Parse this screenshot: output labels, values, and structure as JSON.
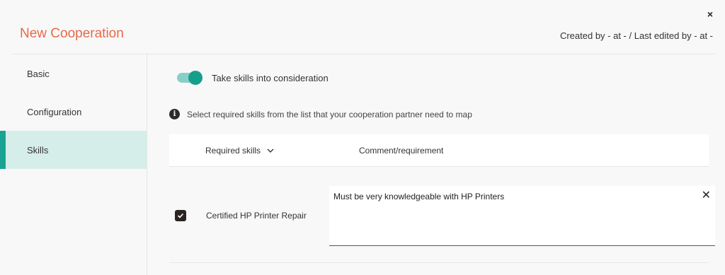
{
  "window": {
    "title": "New Cooperation",
    "meta": "Created by - at - / Last edited by - at -",
    "close_label": "×"
  },
  "sidebar": {
    "items": [
      {
        "label": "Basic",
        "active": false
      },
      {
        "label": "Configuration",
        "active": false
      },
      {
        "label": "Skills",
        "active": true
      }
    ]
  },
  "skills": {
    "toggle_label": "Take skills into consideration",
    "toggle_on": true,
    "info_text": "Select required skills from the list that your cooperation partner need to map",
    "info_icon_glyph": "i",
    "columns": {
      "skills": "Required skills",
      "comment": "Comment/requirement"
    },
    "rows": [
      {
        "checked": true,
        "skill": "Certified HP Printer Repair",
        "comment": "Must be very knowledgeable with HP Printers",
        "clear_label": "✕"
      }
    ]
  },
  "colors": {
    "accent": "#1aa392",
    "title": "#e8694a",
    "active_bg": "#d6eeea"
  }
}
